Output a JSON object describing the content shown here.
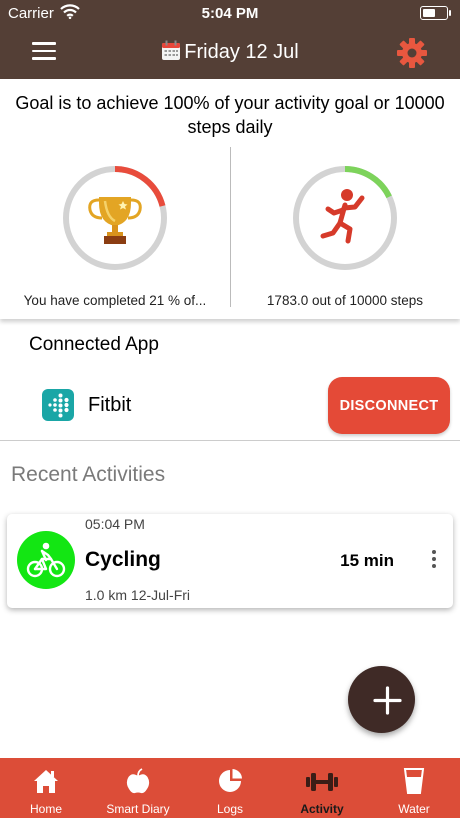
{
  "status_bar": {
    "carrier": "Carrier",
    "time": "5:04 PM"
  },
  "header": {
    "title": "Friday 12 Jul"
  },
  "goal": {
    "text": "Goal is to achieve 100% of your activity goal or 10000 steps daily",
    "activity": {
      "percent": 21,
      "caption": "You have completed 21 % of..."
    },
    "steps": {
      "current": 1783.0,
      "target": 10000,
      "caption": "1783.0 out of 10000 steps"
    }
  },
  "connected": {
    "title": "Connected App",
    "app_name": "Fitbit",
    "disconnect_label": "DISCONNECT"
  },
  "recent": {
    "title": "Recent Activities",
    "items": [
      {
        "time": "05:04 PM",
        "name": "Cycling",
        "duration": "15 min",
        "meta": "1.0 km 12-Jul-Fri"
      }
    ]
  },
  "tabs": [
    {
      "label": "Home",
      "icon": "home-icon"
    },
    {
      "label": "Smart Diary",
      "icon": "apple-icon"
    },
    {
      "label": "Logs",
      "icon": "pie-chart-icon"
    },
    {
      "label": "Activity",
      "icon": "dumbbell-icon",
      "active": true
    },
    {
      "label": "Water",
      "icon": "glass-icon"
    }
  ],
  "colors": {
    "header": "#543f36",
    "accent": "#e44a37",
    "ring_activity": "#e84c3c",
    "ring_steps": "#7dd35b",
    "activity_avatar": "#13e613",
    "tabbar": "#dc4d38"
  }
}
